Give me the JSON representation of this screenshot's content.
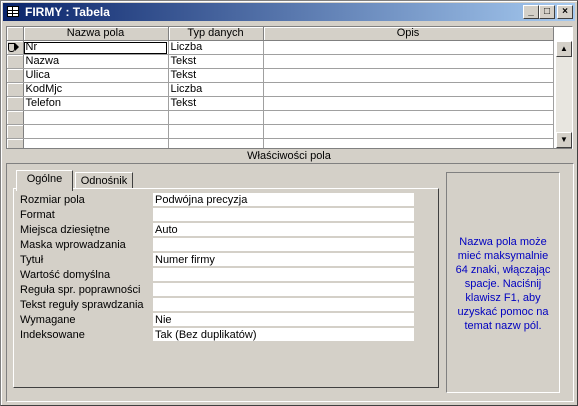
{
  "window": {
    "title": "FIRMY : Tabela",
    "minimize_label": "_",
    "maximize_label": "□",
    "close_label": "×"
  },
  "grid": {
    "headers": [
      "Nazwa pola",
      "Typ danych",
      "Opis"
    ],
    "rows": [
      {
        "name": "Nr",
        "type": "Liczba",
        "desc": ""
      },
      {
        "name": "Nazwa",
        "type": "Tekst",
        "desc": ""
      },
      {
        "name": "Ulica",
        "type": "Tekst",
        "desc": ""
      },
      {
        "name": "KodMjc",
        "type": "Liczba",
        "desc": ""
      },
      {
        "name": "Telefon",
        "type": "Tekst",
        "desc": ""
      }
    ],
    "scroll_up": "▲",
    "scroll_down": "▼"
  },
  "properties": {
    "bar_title": "Właściwości pola",
    "tabs": [
      "Ogólne",
      "Odnośnik"
    ],
    "items": [
      {
        "label": "Rozmiar pola",
        "value": "Podwójna precyzja"
      },
      {
        "label": "Format",
        "value": ""
      },
      {
        "label": "Miejsca dziesiętne",
        "value": "Auto"
      },
      {
        "label": "Maska wprowadzania",
        "value": ""
      },
      {
        "label": "Tytuł",
        "value": "Numer firmy"
      },
      {
        "label": "Wartość domyślna",
        "value": ""
      },
      {
        "label": "Reguła spr. poprawności",
        "value": ""
      },
      {
        "label": "Tekst reguły sprawdzania",
        "value": ""
      },
      {
        "label": "Wymagane",
        "value": "Nie"
      },
      {
        "label": "Indeksowane",
        "value": "Tak (Bez duplikatów)"
      }
    ],
    "help_text": "Nazwa pola może mieć maksymalnie 64 znaki, włączając spacje. Naciśnij klawisz F1, aby uzyskać pomoc na temat nazw pól.",
    "help_color": "#0000c0"
  }
}
